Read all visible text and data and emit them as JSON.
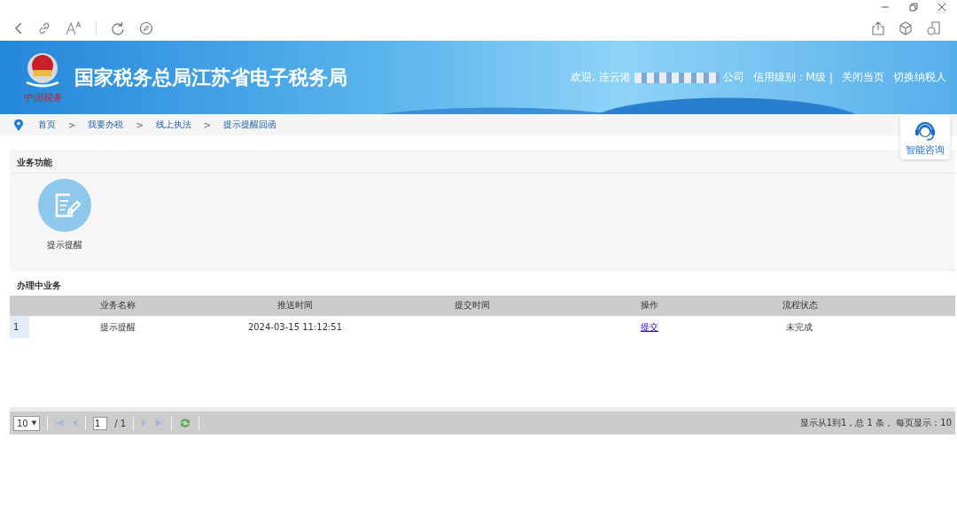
{
  "banner": {
    "logo_caption": "中国税务",
    "title": "国家税务总局江苏省电子税务局",
    "welcome_prefix": "欢迎, 连云港",
    "welcome_suffix": "公司",
    "credit": "信用级别：M级",
    "separator": "|",
    "links": [
      "关闭当页",
      "切换纳税人"
    ]
  },
  "breadcrumb": {
    "items": [
      {
        "label": "首页"
      },
      {
        "label": "我要办税"
      },
      {
        "label": "线上执法"
      },
      {
        "label": "提示提醒回函"
      }
    ],
    "separators": [
      ">",
      ">",
      ">"
    ]
  },
  "assistant": {
    "label": "智能咨询"
  },
  "functions": {
    "title": "业务功能",
    "items": [
      {
        "label": "提示提醒"
      }
    ]
  },
  "tasks": {
    "title": "办理中业务",
    "columns": [
      "业务名称",
      "推送时间",
      "提交时间",
      "操作",
      "流程状态"
    ],
    "rows": [
      {
        "index": "1",
        "name": "提示提醒",
        "pushed": "2024-03-15 11:12:51",
        "action": "提交",
        "status": "未完成"
      }
    ]
  },
  "pager": {
    "page_size": "10",
    "dropdown": "▼",
    "page": "1",
    "total_pages": "/ 1",
    "summary": "显示从1到1，总 1 条 。每页显示：10"
  }
}
